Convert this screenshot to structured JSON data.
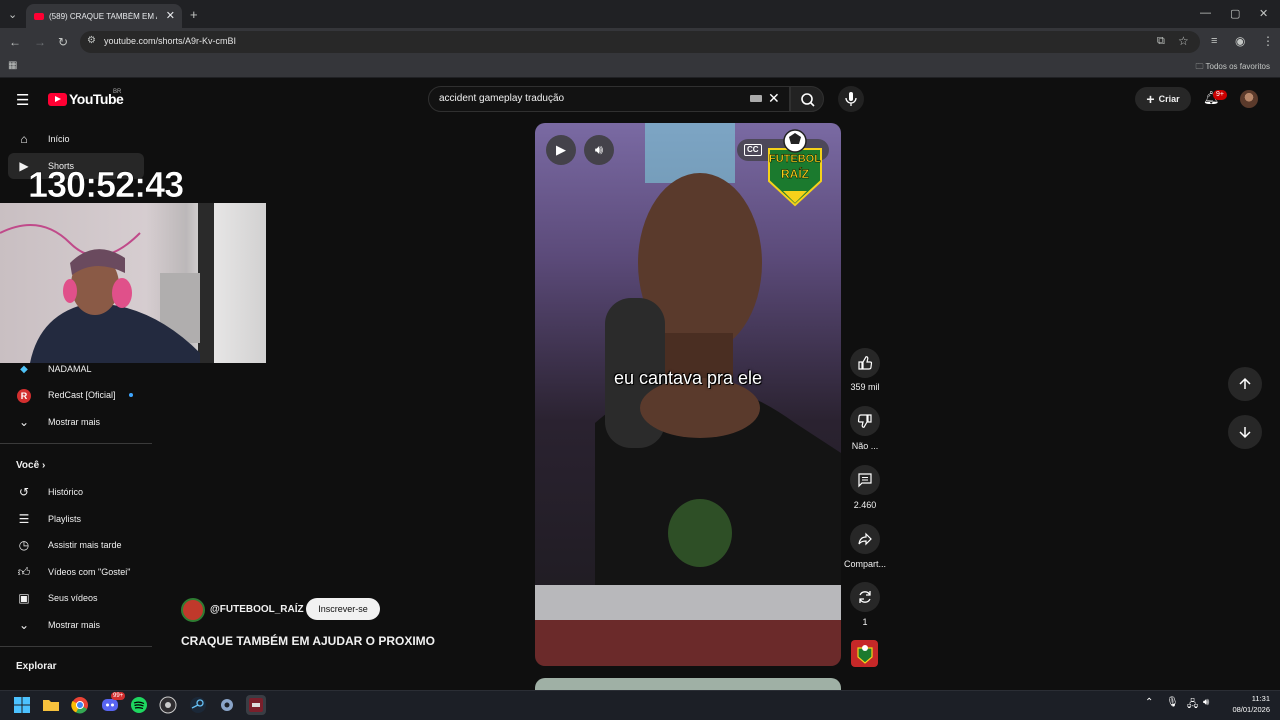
{
  "browser": {
    "tab_title": "(589) CRAQUE TAMBÉM EM AJUDAR O PROXIMO",
    "url": "youtube.com/shorts/A9r-Kv-cmBI",
    "bookmarks_label": "Todos os favoritos"
  },
  "youtube": {
    "logo_text": "YouTube",
    "logo_region": "BR",
    "search_query": "accident gameplay tradução",
    "create_label": "Criar",
    "notifications_badge": "9+"
  },
  "sidebar": {
    "top_items": [
      {
        "label": "Início",
        "icon": "home-icon"
      },
      {
        "label": "Shorts",
        "icon": "shorts-icon"
      }
    ],
    "subscriptions": [
      {
        "label": "NADAMAL",
        "icon": "channel-avatar"
      },
      {
        "label": "RedCast [Oficial]",
        "icon": "channel-avatar"
      },
      {
        "label": "Mostrar mais",
        "icon": "chevron-down-icon"
      }
    ],
    "you_section": "Você",
    "you_items": [
      {
        "label": "Histórico",
        "icon": "history-icon"
      },
      {
        "label": "Playlists",
        "icon": "playlist-icon"
      },
      {
        "label": "Assistir mais tarde",
        "icon": "clock-icon"
      },
      {
        "label": "Vídeos com \"Gostei\"",
        "icon": "thumb-up-icon"
      },
      {
        "label": "Seus vídeos",
        "icon": "video-icon"
      },
      {
        "label": "Mostrar mais",
        "icon": "chevron-down-icon"
      }
    ],
    "explore_section": "Explorar"
  },
  "overlay": {
    "timer": "130:52:43"
  },
  "short": {
    "caption": "eu cantava pra ele",
    "channel_handle": "@FUTEBOOL_RAÍZ",
    "subscribe_label": "Inscrever-se",
    "title": "CRAQUE TAMBÉM EM AJUDAR O PROXIMO",
    "logo_line1": "FUTEBOL",
    "logo_line2": "RAÍZ",
    "cc_label": "CC"
  },
  "actions": {
    "likes": "359 mil",
    "dislike_label": "Não ...",
    "comments": "2.460",
    "share_label": "Compart...",
    "remix_count": "1"
  },
  "taskbar": {
    "time": "11:31",
    "date": "08/01/2026",
    "discord_badge": "99+"
  },
  "colors": {
    "yt_red": "#ff0033",
    "background": "#0f0f0f"
  }
}
